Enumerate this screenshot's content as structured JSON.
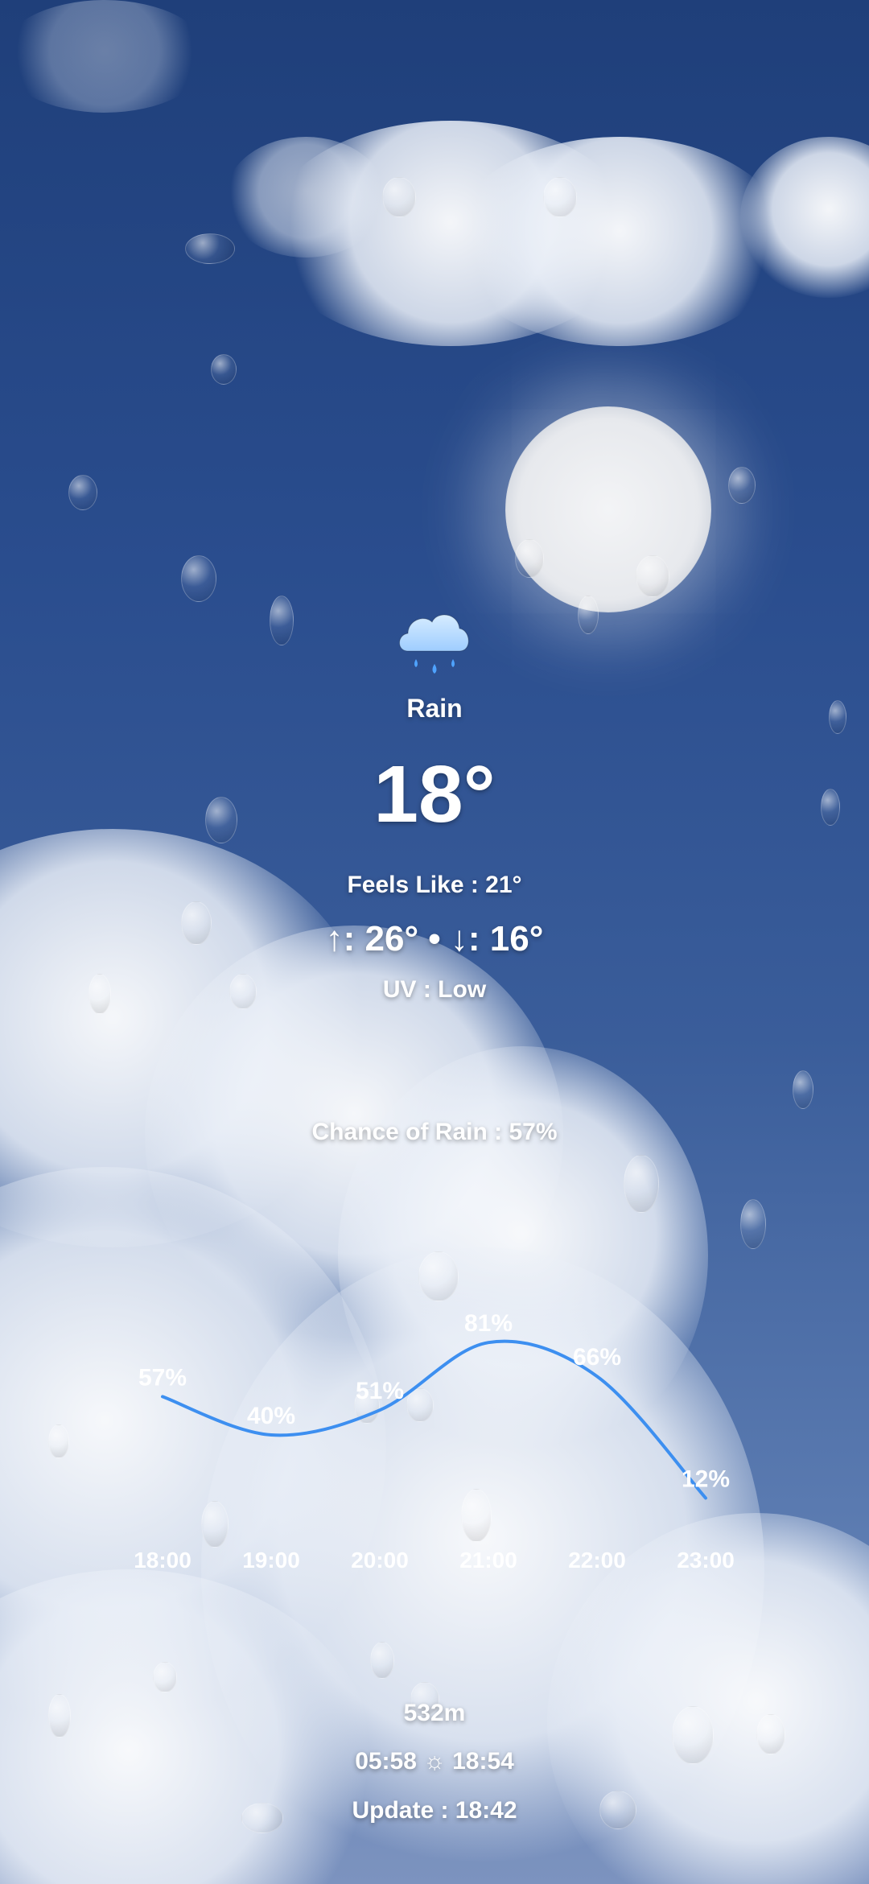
{
  "weather": {
    "icon": "rain-cloud-icon",
    "condition": "Rain",
    "temperature": "18°",
    "feels_like": "Feels Like : 21°",
    "high_low": "↑: 26° • ↓: 16°",
    "uv": "UV : Low",
    "chance_of_rain": "Chance of Rain : 57%"
  },
  "footer": {
    "altitude": "532m",
    "sunrise_sunset": "05:58 ☼ 18:54",
    "update": "Update : 18:42"
  },
  "colors": {
    "curve": "#3d8ff0",
    "icon_cloud": "#bfe0ff",
    "icon_drop": "#4fa3ff"
  },
  "chart_data": {
    "type": "line",
    "categories": [
      "18:00",
      "19:00",
      "20:00",
      "21:00",
      "22:00",
      "23:00"
    ],
    "series": [
      {
        "values": [
          57,
          40,
          51,
          81,
          66,
          12
        ]
      }
    ],
    "data_labels": [
      "57%",
      "40%",
      "51%",
      "81%",
      "66%",
      "12%"
    ],
    "ylim": [
      0,
      100
    ],
    "grid": false
  }
}
